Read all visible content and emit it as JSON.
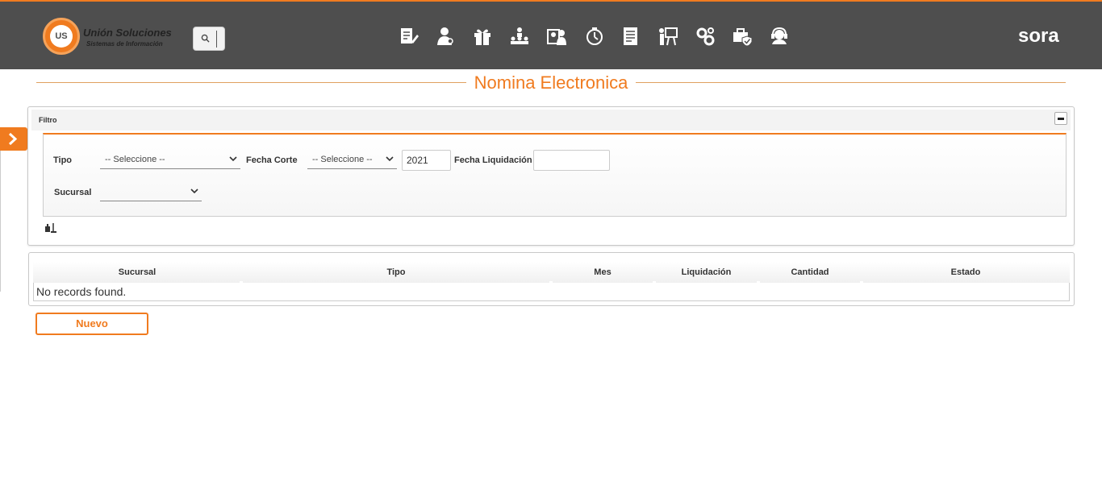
{
  "header": {
    "logo": {
      "monogram": "US",
      "name": "Unión Soluciones",
      "tagline": "Sistemas de Información"
    },
    "search_icon": "search-icon",
    "nav_icons": [
      "document-edit-icon",
      "employee-icon",
      "gift-icon",
      "org-chart-icon",
      "id-card-icon",
      "timer-icon",
      "report-icon",
      "training-icon",
      "settings-gears-icon",
      "medical-bag-icon",
      "support-agent-icon"
    ],
    "brand": "sora"
  },
  "page": {
    "title": "Nomina Electronica"
  },
  "colors": {
    "accent": "#f07b1f",
    "topbar": "#4e4e4e"
  },
  "filter": {
    "panel_title": "Filtro",
    "tipo_label": "Tipo",
    "tipo_value": "-- Seleccione --",
    "fecha_corte_label": "Fecha Corte",
    "fecha_corte_value": "-- Seleccione --",
    "year_value": "2021",
    "fecha_liquidacion_label": "Fecha Liquidación",
    "fecha_liquidacion_value": "",
    "sucursal_label": "Sucursal",
    "sucursal_value": ""
  },
  "table": {
    "columns": [
      "Sucursal",
      "Tipo",
      "Mes",
      "Liquidación",
      "Cantidad",
      "Estado"
    ],
    "empty_message": "No records found."
  },
  "actions": {
    "new_label": "Nuevo"
  }
}
